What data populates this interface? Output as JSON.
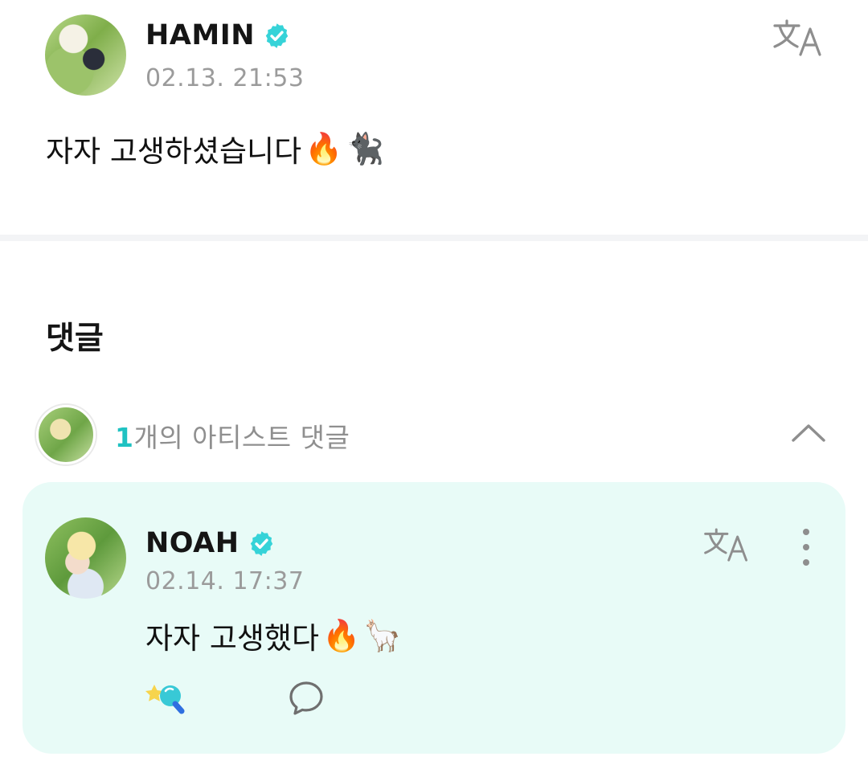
{
  "post": {
    "author": "HAMIN",
    "timestamp": "02.13. 21:53",
    "text": "자자 고생하셨습니다",
    "emojis": [
      "🔥",
      "🐈‍⬛"
    ]
  },
  "comments": {
    "heading": "댓글",
    "artist_count": "1",
    "artist_label": "개의 아티스트 댓글",
    "items": [
      {
        "author": "NOAH",
        "timestamp": "02.14. 17:37",
        "text": "자자 고생했다",
        "emojis": [
          "🔥",
          "🦙"
        ]
      }
    ]
  },
  "icons": {
    "verified": "verified-badge-icon",
    "translate": "translate-icon",
    "collapse": "chevron-up-icon",
    "more": "more-vertical-icon",
    "reaction": "reaction-icon",
    "reply": "speech-bubble-icon"
  },
  "colors": {
    "accent": "#1fc2c2",
    "verified": "#36d3d8",
    "card_background": "#e8fbf7",
    "muted_text": "#9b9b9b"
  }
}
